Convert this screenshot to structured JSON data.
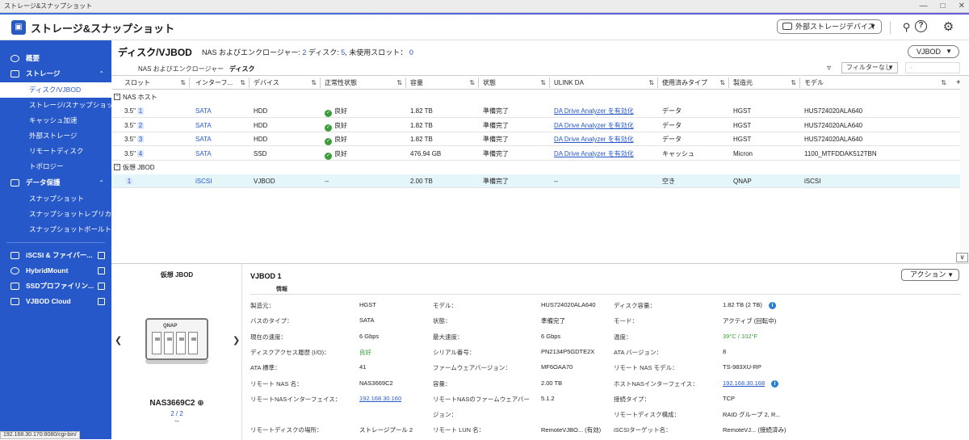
{
  "window": {
    "title": "ストレージ&スナップショット"
  },
  "header": {
    "app_title": "ストレージ&スナップショット",
    "external_device_label": "外部ストレージデバイス"
  },
  "sidebar": {
    "overview": "概要",
    "storage": "ストレージ",
    "storage_items": [
      "ディスク/VJBOD",
      "ストレージ/スナップショット",
      "キャッシュ加速",
      "外部ストレージ",
      "リモートディスク",
      "トポロジー"
    ],
    "data_protection": "データ保護",
    "protection_items": [
      "スナップショット",
      "スナップショットレプリカ",
      "スナップショットボールト"
    ],
    "links": [
      "iSCSI & ファイバー...",
      "HybridMount",
      "SSDプロファイリン...",
      "VJBOD Cloud"
    ]
  },
  "status_url": "192.168.30.170:8080/cgi-bin/",
  "main": {
    "page_title": "ディスク/VJBOD",
    "summary_label1": "NAS およびエンクロージャー: ",
    "summary_num1": "2",
    "summary_label2": " ディスク: ",
    "summary_num2": "5",
    "summary_label3": ", 未使用スロット： ",
    "summary_num3": "0",
    "vjbod_button": "VJBOD",
    "tabs": [
      "NAS およびエンクロージャー",
      "ディスク"
    ],
    "filter_label": "フィルターなし",
    "filter_placeholder": "-"
  },
  "table": {
    "columns": [
      "スロット",
      "インターフ...",
      "デバイス",
      "正常性状態",
      "容量",
      "状態",
      "ULINK DA",
      "使用済みタイプ",
      "製造元",
      "モデル"
    ],
    "group_nas": "NAS ホスト",
    "group_vjbod": "仮想 JBOD",
    "nas_rows": [
      {
        "slot_prefix": "3.5\"",
        "slot_num": "1",
        "interface": "SATA",
        "device": "HDD",
        "health": "良好",
        "capacity": "1.82 TB",
        "state": "準備完了",
        "ulink": "DA Drive Analyzer を有効化",
        "type": "データ",
        "vendor": "HGST",
        "model": "HUS724020ALA640"
      },
      {
        "slot_prefix": "3.5\"",
        "slot_num": "2",
        "interface": "SATA",
        "device": "HDD",
        "health": "良好",
        "capacity": "1.82 TB",
        "state": "準備完了",
        "ulink": "DA Drive Analyzer を有効化",
        "type": "データ",
        "vendor": "HGST",
        "model": "HUS724020ALA640"
      },
      {
        "slot_prefix": "3.5\"",
        "slot_num": "3",
        "interface": "SATA",
        "device": "HDD",
        "health": "良好",
        "capacity": "1.82 TB",
        "state": "準備完了",
        "ulink": "DA Drive Analyzer を有効化",
        "type": "データ",
        "vendor": "HGST",
        "model": "HUS724020ALA640"
      },
      {
        "slot_prefix": "3.5\"",
        "slot_num": "4",
        "interface": "SATA",
        "device": "SSD",
        "health": "良好",
        "capacity": "476.94 GB",
        "state": "準備完了",
        "ulink": "DA Drive Analyzer を有効化",
        "type": "キャッシュ",
        "vendor": "Micron",
        "model": "1100_MTFDDAK512TBN"
      }
    ],
    "vjbod_row": {
      "slot_num": "1",
      "interface": "iSCSI",
      "device": "VJBOD",
      "health": "--",
      "capacity": "2.00 TB",
      "state": "準備完了",
      "ulink": "--",
      "type": "空き",
      "vendor": "QNAP",
      "model": "iSCSI"
    }
  },
  "detail": {
    "left_title": "仮想 JBOD",
    "device_brand": "QNAP",
    "device_name": "NAS3669C2",
    "device_page": "2 / 2",
    "device_dash": "--",
    "panel_title": "VJBOD 1",
    "section": "情報",
    "action_button": "アクション",
    "col1": [
      {
        "k": "製造元：",
        "v": "HGST"
      },
      {
        "k": "バスのタイプ：",
        "v": "SATA"
      },
      {
        "k": "現在の速度：",
        "v": "6 Gbps"
      },
      {
        "k": "ディスクアクセス履歴 (I/O)：",
        "v": "良好"
      },
      {
        "k": "ATA 標準：",
        "v": "41"
      },
      {
        "k": "リモート NAS 名：",
        "v": "NAS3669C2"
      },
      {
        "k": "リモートNASインターフェイス：",
        "v": "192.168.30.160"
      },
      {
        "k": "",
        "v": ""
      },
      {
        "k": "リモートディスクの場所：",
        "v": "ストレージプール 2"
      }
    ],
    "col2": [
      {
        "k": "モデル：",
        "v": "HUS724020ALA640"
      },
      {
        "k": "状態：",
        "v": "準備完了"
      },
      {
        "k": "最大速度：",
        "v": "6 Gbps"
      },
      {
        "k": "シリアル番号：",
        "v": "PN2134P5GDTE2X"
      },
      {
        "k": "ファームウェアバージョン：",
        "v": "MF6OAA70"
      },
      {
        "k": "容量：",
        "v": "2.00 TB"
      },
      {
        "k": "リモートNASのファームウェアバー",
        "v": "5.1.2"
      },
      {
        "k": "ジョン：",
        "v": ""
      },
      {
        "k": "リモート LUN 名：",
        "v": "RemoteVJBO... (有効)"
      }
    ],
    "col3": [
      {
        "k": "ディスク容量：",
        "v": "1.82 TB (2 TB)"
      },
      {
        "k": "モード：",
        "v": "アクティブ (回転中)"
      },
      {
        "k": "温度：",
        "v": "39°C / 102°F"
      },
      {
        "k": "ATA バージョン：",
        "v": "8"
      },
      {
        "k": "リモート NAS モデル：",
        "v": "TS-983XU-RP"
      },
      {
        "k": "ホストNASインターフェイス：",
        "v": "192.168.30.168"
      },
      {
        "k": "接続タイプ：",
        "v": "TCP"
      },
      {
        "k": "リモートディスク構成：",
        "v": "RAID グループ 2, R..."
      },
      {
        "k": "iSCSIターゲット名：",
        "v": "RemoteVJ... (接続済み)"
      }
    ]
  },
  "colors": {
    "accent": "#2758c9",
    "ok": "#3a9d3a",
    "selected_row": "#e4f6fa"
  }
}
